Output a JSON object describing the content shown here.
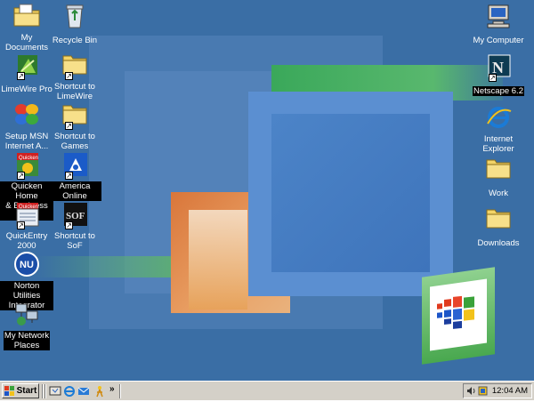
{
  "desktop": {
    "icons_left": [
      {
        "label": "My Documents",
        "icon": "folder-documents-icon"
      },
      {
        "label": "LimeWire Pro",
        "icon": "limewire-icon"
      },
      {
        "label": "Setup MSN\nInternet A...",
        "icon": "msn-butterfly-icon"
      },
      {
        "label": "Quicken Home\n& Business 2...",
        "icon": "quicken-icon"
      },
      {
        "label": "QuickEntry\n2000",
        "icon": "quickentry-icon"
      },
      {
        "label": "Norton Utilities\nIntegrator",
        "icon": "norton-icon"
      },
      {
        "label": "My Network\nPlaces",
        "icon": "network-places-icon"
      }
    ],
    "icons_col2": [
      {
        "label": "Recycle Bin",
        "icon": "recycle-bin-icon"
      },
      {
        "label": "Shortcut to\nLimeWire",
        "icon": "folder-shortcut-icon"
      },
      {
        "label": "Shortcut to\nGames",
        "icon": "folder-shortcut-icon"
      },
      {
        "label": "America Online",
        "icon": "aol-icon"
      },
      {
        "label": "Shortcut to\nSoF",
        "icon": "sof-icon"
      }
    ],
    "icons_right": [
      {
        "label": "My Computer",
        "icon": "my-computer-icon"
      },
      {
        "label": "Netscape 6.2",
        "icon": "netscape-icon"
      },
      {
        "label": "Internet\nExplorer",
        "icon": "internet-explorer-icon"
      },
      {
        "label": "Work",
        "icon": "folder-icon"
      },
      {
        "label": "Downloads",
        "icon": "folder-icon"
      }
    ]
  },
  "taskbar": {
    "start_label": "Start",
    "quick_launch": [
      "show-desktop-icon",
      "internet-explorer-icon",
      "outlook-icon",
      "aim-icon"
    ],
    "chevron": "»",
    "tray_icons": [
      "volume-icon",
      "tray-app-icon"
    ],
    "clock": "12:04 AM"
  },
  "colors": {
    "desktop_bg": "#3a6ea5",
    "taskbar_bg": "#d4d0c8",
    "selection": "#0a246a"
  }
}
